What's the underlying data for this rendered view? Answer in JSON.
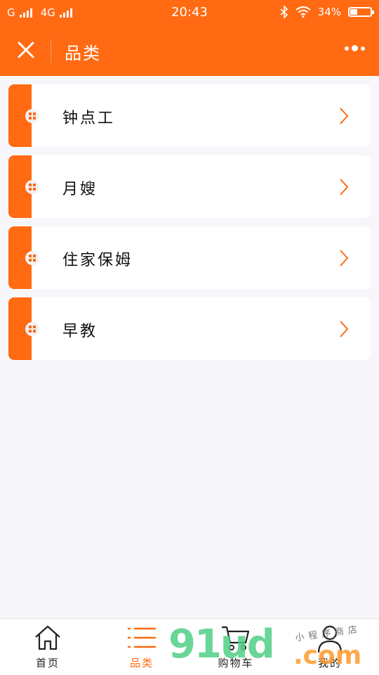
{
  "status_bar": {
    "carrier1": "G",
    "carrier2": "4G",
    "time": "20:43",
    "battery": "34%",
    "battery_level": 0.34
  },
  "nav": {
    "title": "品类"
  },
  "categories": [
    {
      "label": "钟点工"
    },
    {
      "label": "月嫂"
    },
    {
      "label": "住家保姆"
    },
    {
      "label": "早教"
    }
  ],
  "tabs": [
    {
      "label": "首页",
      "icon": "home-icon"
    },
    {
      "label": "品类",
      "icon": "list-icon",
      "active": true
    },
    {
      "label": "购物车",
      "icon": "cart-icon"
    },
    {
      "label": "我的",
      "icon": "user-icon"
    }
  ],
  "watermark": {
    "brand": "91ud",
    "domain": ".com",
    "shop": "小程序商店"
  },
  "colors": {
    "accent": "#ff6a12",
    "background": "#f7f7fb"
  }
}
